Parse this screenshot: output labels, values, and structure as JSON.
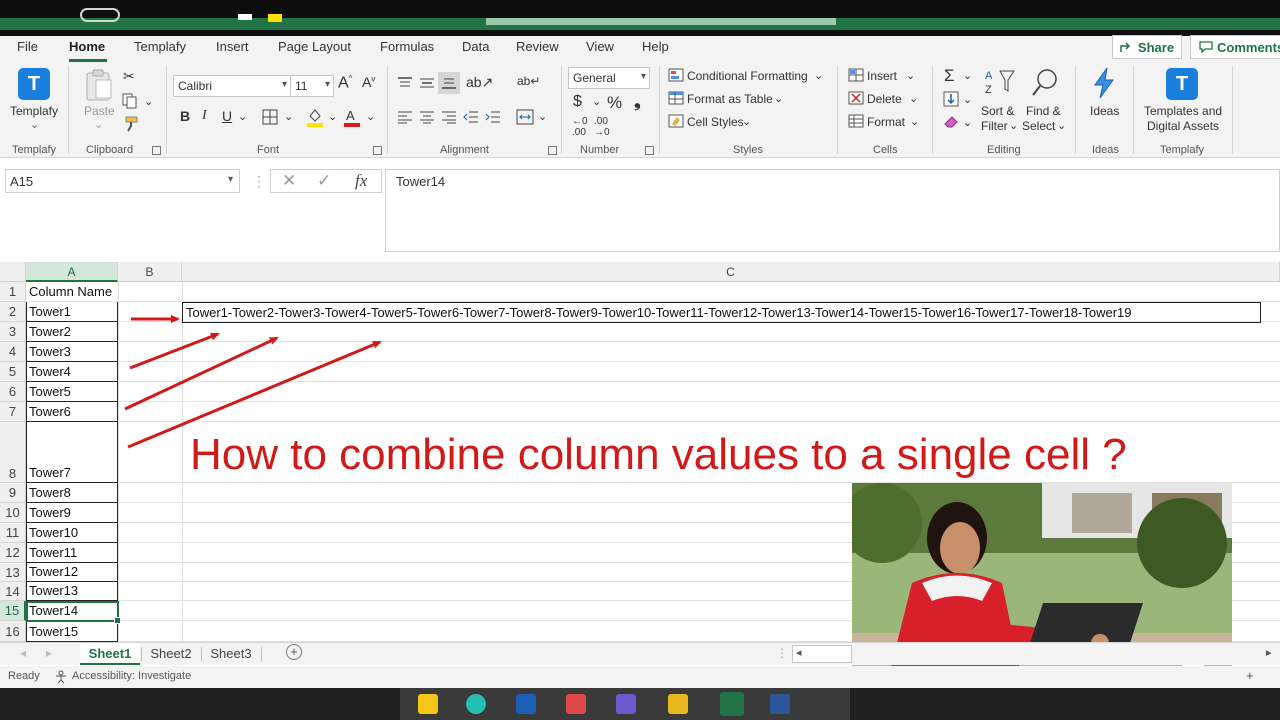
{
  "menu": {
    "tabs": [
      "File",
      "Home",
      "Templafy",
      "Insert",
      "Page Layout",
      "Formulas",
      "Data",
      "Review",
      "View",
      "Help"
    ],
    "active": "Home",
    "share": "Share",
    "comments": "Comments"
  },
  "ribbon": {
    "templafy": {
      "label": "Templafy",
      "group": "Templafy"
    },
    "clipboard": {
      "paste": "Paste",
      "group": "Clipboard"
    },
    "font": {
      "name": "Calibri",
      "size": "11",
      "group": "Font",
      "bold": "B",
      "italic": "I",
      "underline": "U"
    },
    "alignment": {
      "group": "Alignment"
    },
    "number": {
      "format": "General",
      "group": "Number"
    },
    "styles": {
      "conditional": "Conditional Formatting",
      "format_table": "Format as Table",
      "cell_styles": "Cell Styles",
      "group": "Styles"
    },
    "cells": {
      "insert": "Insert",
      "delete": "Delete",
      "format": "Format",
      "group": "Cells"
    },
    "editing": {
      "sort_1": "Sort &",
      "sort_2": "Filter",
      "find_1": "Find &",
      "find_2": "Select",
      "group": "Editing"
    },
    "ideas": {
      "label": "Ideas",
      "group": "Ideas"
    },
    "assets": {
      "label_1": "Templates and",
      "label_2": "Digital Assets",
      "group": "Templafy"
    }
  },
  "formula_bar": {
    "name_box": "A15",
    "formula": "Tower14"
  },
  "grid": {
    "columns": [
      "A",
      "B",
      "C"
    ],
    "rows": [
      "1",
      "2",
      "3",
      "4",
      "5",
      "6",
      "7",
      "8",
      "9",
      "10",
      "11",
      "12",
      "13",
      "14",
      "15",
      "16"
    ],
    "column_a": [
      "Column Name",
      "Tower1",
      "Tower2",
      "Tower3",
      "Tower4",
      "Tower5",
      "Tower6",
      "Tower7",
      "Tower8",
      "Tower9",
      "Tower10",
      "Tower11",
      "Tower12",
      "Tower13",
      "Tower14",
      "Tower15"
    ],
    "concat_value": "Tower1-Tower2-Tower3-Tower4-Tower5-Tower6-Tower7-Tower8-Tower9-Tower10-Tower11-Tower12-Tower13-Tower14-Tower15-Tower16-Tower17-Tower18-Tower19",
    "selected_cell": "A15"
  },
  "overlay": {
    "headline": "How to combine column values to a single cell ?",
    "arrow_color": "#d11919"
  },
  "sheets": {
    "tabs": [
      "Sheet1",
      "Sheet2",
      "Sheet3"
    ],
    "active": "Sheet1"
  },
  "status": {
    "ready": "Ready",
    "accessibility": "Accessibility: Investigate"
  },
  "colors": {
    "accent": "#217346",
    "templafy_blue": "#1a7fdc"
  }
}
